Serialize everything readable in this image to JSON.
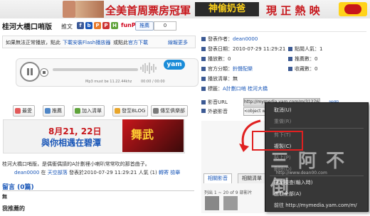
{
  "banner": {
    "title_left": "全美首周票房冠軍",
    "title_mid": "神偷奶爸",
    "title_right": "現 正 熱 映"
  },
  "page": {
    "title": "桂河大橋口哨版"
  },
  "share": {
    "label": "推文",
    "icons": [
      "f",
      "b",
      "P",
      "P",
      "H",
      "@"
    ],
    "funp": "funP",
    "push_label": "推薦",
    "push_count": "0"
  },
  "notice": {
    "text": "如果無法正常播放，點此",
    "link1": "下載安裝Flash播放器",
    "text2": "，或點此",
    "link2": "官方下載",
    "more": "線報更多"
  },
  "player": {
    "caption": "Mp3 must be 11.22.44khz",
    "time": "00:00 / 00:00",
    "brand": "yam"
  },
  "actions": [
    "最愛",
    "推薦",
    "加入清單",
    "發至BLOG",
    "傳至俱樂部"
  ],
  "ad": {
    "date": "8月21, 22日",
    "tagline": "與你相遇在碧潭",
    "art_text": "舞武"
  },
  "description": "桂河大橋口哨版，是偶衝偶請的A計劃裡小喇叭常常吹的那首曲子。",
  "meta": {
    "user": "dean0000",
    "in": "在",
    "club": "天空部落",
    "posted": "發表於2010-07-29 11:29:21",
    "people": "人氣 (1)",
    "links": [
      "轉寄",
      "檢舉"
    ]
  },
  "comments": {
    "header": "留言 (0篇)",
    "none": "無",
    "more": "我推薦的"
  },
  "info": {
    "rows": [
      {
        "label": "發表作者：",
        "value": "dean0000"
      },
      {
        "label": "發表日期：",
        "value": "2010-07-29 11:29:21"
      },
      {
        "label": "播放數：",
        "value": "0"
      },
      {
        "label": "官方分類：",
        "value": "鈴聲配樂"
      },
      {
        "label": "播放清單：",
        "value": "無"
      },
      {
        "label": "標籤：",
        "value": "A計劃口哨 桂河大橋"
      }
    ],
    "right_rows": [
      {
        "label": "點閱人氣：",
        "value": "1"
      },
      {
        "label": "推薦數：",
        "value": "0"
      },
      {
        "label": "收藏數：",
        "value": "0"
      }
    ],
    "url_label": "影音URL",
    "url_value": "http://mymedia.yam.com/m/3127638",
    "embed_label": "外嵌影音",
    "embed_value": "<object width=",
    "help": "說明"
  },
  "tabs": [
    "相關影音",
    "相關清單"
  ],
  "list": {
    "header": "列出 1 ~ 20 of 9 部影片"
  },
  "context_menu": {
    "items": [
      {
        "label": "取消(U)",
        "enabled": true
      },
      {
        "label": "重做(R)",
        "enabled": false
      },
      {
        "label": "剪下(T)",
        "enabled": false
      },
      {
        "label": "複製(C)",
        "enabled": true
      },
      {
        "label": "貼上(P)",
        "enabled": false
      },
      {
        "label": "刪除(D)",
        "enabled": false
      },
      {
        "label": "拼字檢查(輸入時)",
        "enabled": true
      },
      {
        "label": "選取全部(A)",
        "enabled": true
      },
      {
        "label": "前往 http://mymedia.yam.com/m/",
        "enabled": true
      }
    ]
  },
  "watermark": {
    "text": "三 阿 不 倒",
    "url": "http://www.dean00.com"
  },
  "colors": {
    "link": "#1a57b8",
    "highlight": "#e02020",
    "menu_bg": "#373737"
  }
}
